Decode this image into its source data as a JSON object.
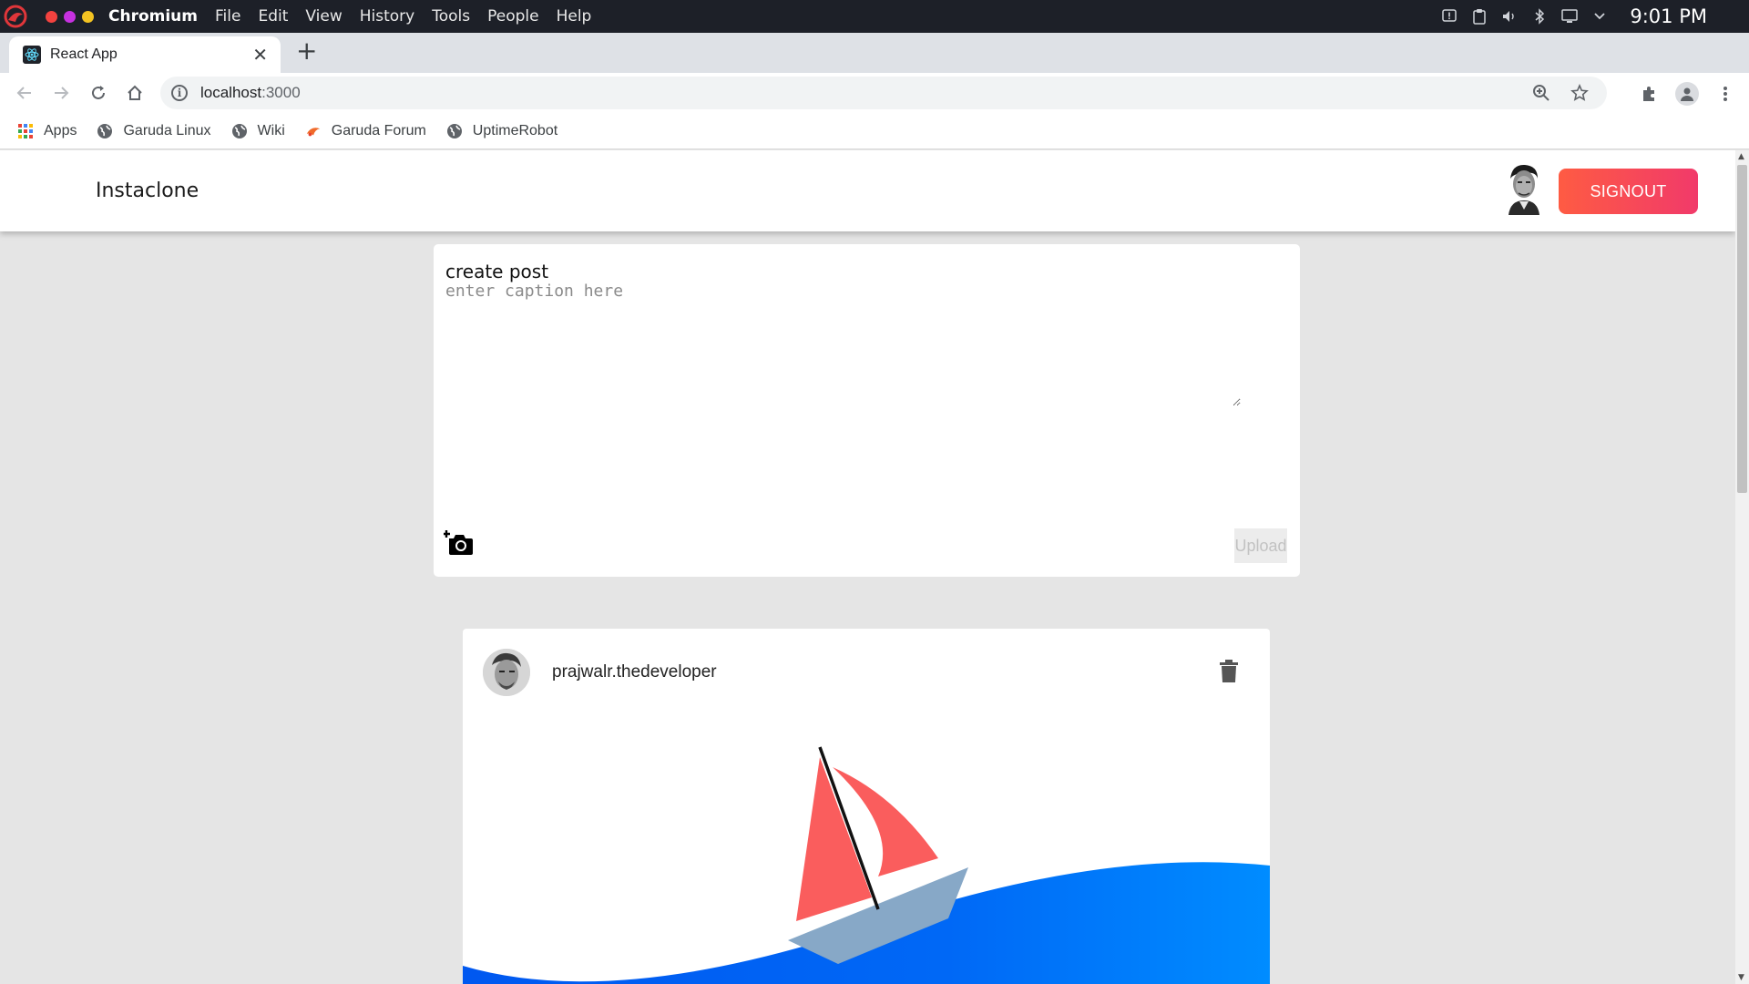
{
  "os": {
    "app_name": "Chromium",
    "menu": [
      "File",
      "Edit",
      "View",
      "History",
      "Tools",
      "People",
      "Help"
    ],
    "clock": "9:01 PM",
    "dot_colors": [
      "#f3423f",
      "#c631e0",
      "#f3c322"
    ]
  },
  "browser": {
    "tab_title": "React App",
    "tab_close": "✕",
    "new_tab": "+",
    "url_host": "localhost",
    "url_port": ":3000",
    "bookmarks": [
      "Apps",
      "Garuda Linux",
      "Wiki",
      "Garuda Forum",
      "UptimeRobot"
    ]
  },
  "app": {
    "brand": "Instaclone",
    "signout_label": "SIGNOUT",
    "accent_gradient": [
      "#fe5b43",
      "#f13a6a"
    ],
    "create_post": {
      "title": "create post",
      "caption_placeholder": "enter caption here",
      "caption_value": "",
      "upload_label": "Upload"
    },
    "post": {
      "username": "prajwalr.thedeveloper",
      "image_colors": {
        "sail": "#fa5d5d",
        "hull": "#87a8c7",
        "wave": "#007bfb"
      }
    }
  }
}
